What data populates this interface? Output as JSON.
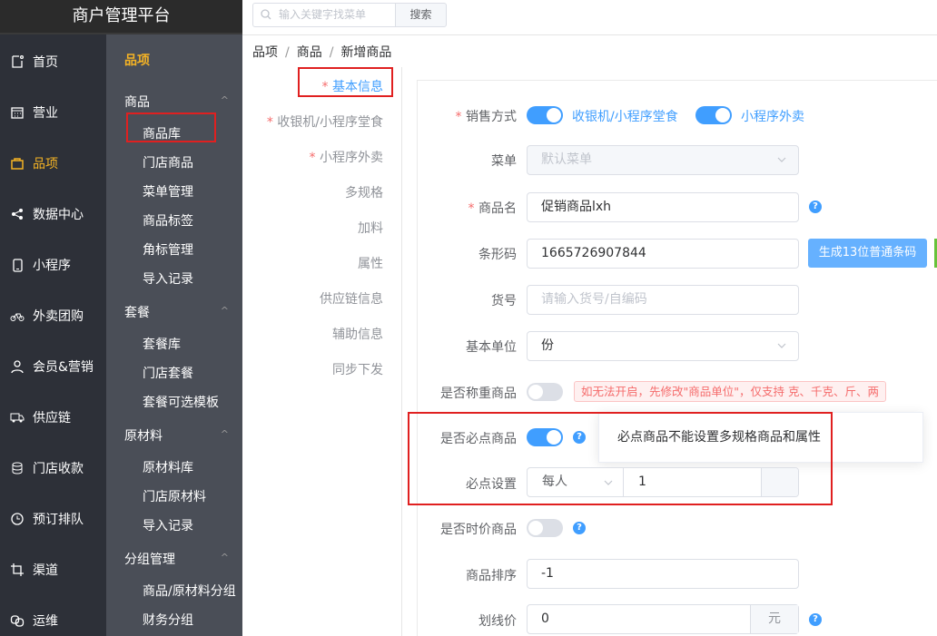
{
  "app": {
    "title": "商户管理平台"
  },
  "topbar": {
    "search_placeholder": "输入关键字找菜单",
    "search_button": "搜索"
  },
  "nav_primary": [
    {
      "label": "首页",
      "icon": "home-icon",
      "active": false
    },
    {
      "label": "营业",
      "icon": "calendar-icon",
      "active": false
    },
    {
      "label": "品项",
      "icon": "bag-icon",
      "active": true
    },
    {
      "label": "数据中心",
      "icon": "share-icon",
      "active": false
    },
    {
      "label": "小程序",
      "icon": "phone-icon",
      "active": false
    },
    {
      "label": "外卖团购",
      "icon": "bike-icon",
      "active": false
    },
    {
      "label": "会员&营销",
      "icon": "user-icon",
      "active": false
    },
    {
      "label": "供应链",
      "icon": "truck-icon",
      "active": false
    },
    {
      "label": "门店收款",
      "icon": "coins-icon",
      "active": false
    },
    {
      "label": "预订排队",
      "icon": "clock-icon",
      "active": false
    },
    {
      "label": "渠道",
      "icon": "crop-icon",
      "active": false
    },
    {
      "label": "运维",
      "icon": "link-icon",
      "active": false
    }
  ],
  "nav_secondary": {
    "header": "品项",
    "groups": [
      {
        "label": "商品",
        "items": [
          "商品库",
          "门店商品",
          "菜单管理",
          "商品标签",
          "角标管理",
          "导入记录"
        ]
      },
      {
        "label": "套餐",
        "items": [
          "套餐库",
          "门店套餐",
          "套餐可选模板"
        ]
      },
      {
        "label": "原材料",
        "items": [
          "原材料库",
          "门店原材料",
          "导入记录"
        ]
      },
      {
        "label": "分组管理",
        "items": [
          "商品/原材料分组",
          "财务分组"
        ]
      }
    ]
  },
  "breadcrumb": [
    "品项",
    "商品",
    "新增商品"
  ],
  "section_tabs": [
    {
      "label": "基本信息",
      "required": true,
      "active": true
    },
    {
      "label": "收银机/小程序堂食",
      "required": true,
      "active": false
    },
    {
      "label": "小程序外卖",
      "required": true,
      "active": false
    },
    {
      "label": "多规格",
      "required": false,
      "active": false
    },
    {
      "label": "加料",
      "required": false,
      "active": false
    },
    {
      "label": "属性",
      "required": false,
      "active": false
    },
    {
      "label": "供应链信息",
      "required": false,
      "active": false
    },
    {
      "label": "辅助信息",
      "required": false,
      "active": false
    },
    {
      "label": "同步下发",
      "required": false,
      "active": false
    }
  ],
  "form": {
    "sale_mode": {
      "label": "销售方式",
      "pos_label": "收银机/小程序堂食",
      "pos_on": true,
      "takeout_label": "小程序外卖",
      "takeout_on": true
    },
    "menu": {
      "label": "菜单",
      "value": "默认菜单"
    },
    "name": {
      "label": "商品名",
      "value": "促销商品lxh"
    },
    "barcode": {
      "label": "条形码",
      "value": "1665726907844",
      "button": "生成13位普通条码"
    },
    "sku": {
      "label": "货号",
      "placeholder": "请输入货号/自编码"
    },
    "unit": {
      "label": "基本单位",
      "value": "份"
    },
    "weighted": {
      "label": "是否称重商品",
      "on": false,
      "warning": "如无法开启，先修改\"商品单位\"，仅支持 克、千克、斤、两"
    },
    "required_item": {
      "label": "是否必点商品",
      "on": true,
      "tooltip": "必点商品不能设置多规格商品和属性"
    },
    "required_setting": {
      "label": "必点设置",
      "option": "每人",
      "value": "1"
    },
    "market_price": {
      "label": "是否时价商品",
      "on": false
    },
    "sort": {
      "label": "商品排序",
      "value": "-1"
    },
    "strike_price": {
      "label": "划线价",
      "value": "0",
      "unit": "元"
    }
  },
  "colors": {
    "accent": "#409eff",
    "nav_active": "#f5b324",
    "highlight": "#e02020"
  }
}
